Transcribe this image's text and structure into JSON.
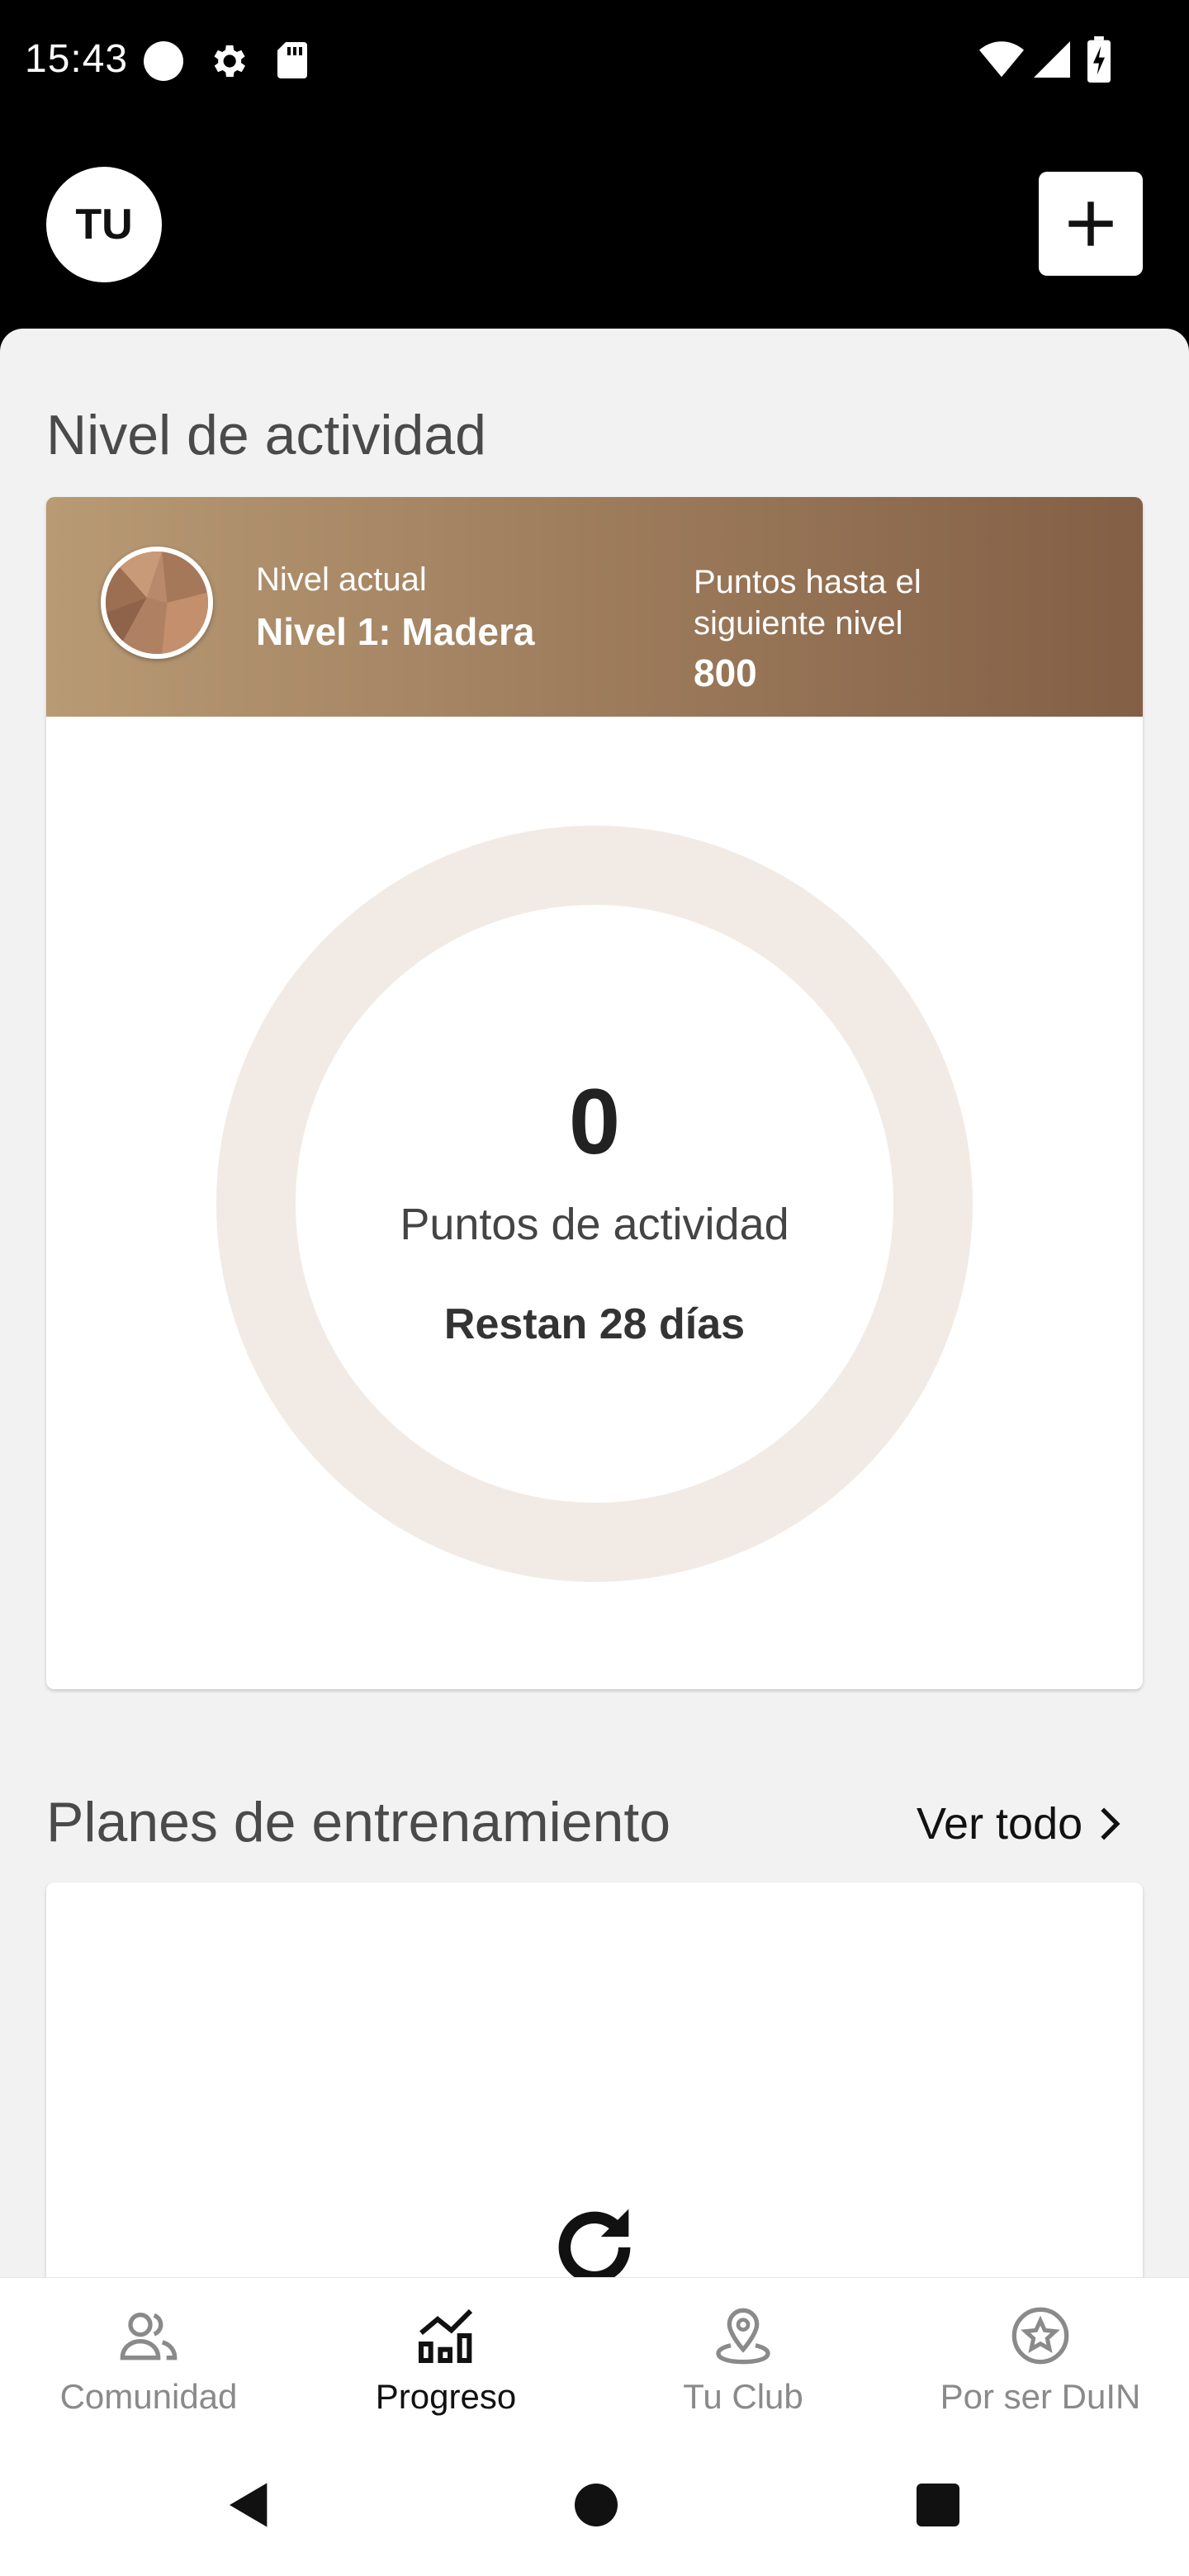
{
  "status_bar": {
    "time": "15:43",
    "icons": [
      "notification-dot-icon",
      "settings-gear-icon",
      "sd-card-icon",
      "wifi-icon",
      "signal-icon",
      "battery-charging-icon"
    ]
  },
  "header": {
    "avatar_initials": "TU",
    "add_button_icon": "plus-icon"
  },
  "activity": {
    "section_title": "Nivel de actividad",
    "current_level_label": "Nivel actual",
    "current_level_value": "Nivel 1: Madera",
    "points_to_next_label": "Puntos hasta el siguiente nivel",
    "points_to_next_value": "800",
    "activity_points": "0",
    "activity_points_label": "Puntos de actividad",
    "days_left": "Restan 28 días",
    "progress_fraction": 0,
    "colors": {
      "banner_start": "#b89a74",
      "banner_end": "#835f45",
      "ring_track": "#f2ebe5"
    }
  },
  "plans": {
    "section_title": "Planes de entrenamiento",
    "see_all_label": "Ver todo",
    "loading_icon": "reload-icon"
  },
  "bottom_nav": {
    "items": [
      {
        "label": "Comunidad",
        "icon": "community-icon",
        "active": false
      },
      {
        "label": "Progreso",
        "icon": "progress-chart-icon",
        "active": true
      },
      {
        "label": "Tu Club",
        "icon": "location-pin-icon",
        "active": false
      },
      {
        "label": "Por ser DuIN",
        "icon": "star-badge-icon",
        "active": false
      }
    ]
  },
  "system_nav": {
    "icons": [
      "back-icon",
      "home-icon",
      "recents-icon"
    ]
  }
}
